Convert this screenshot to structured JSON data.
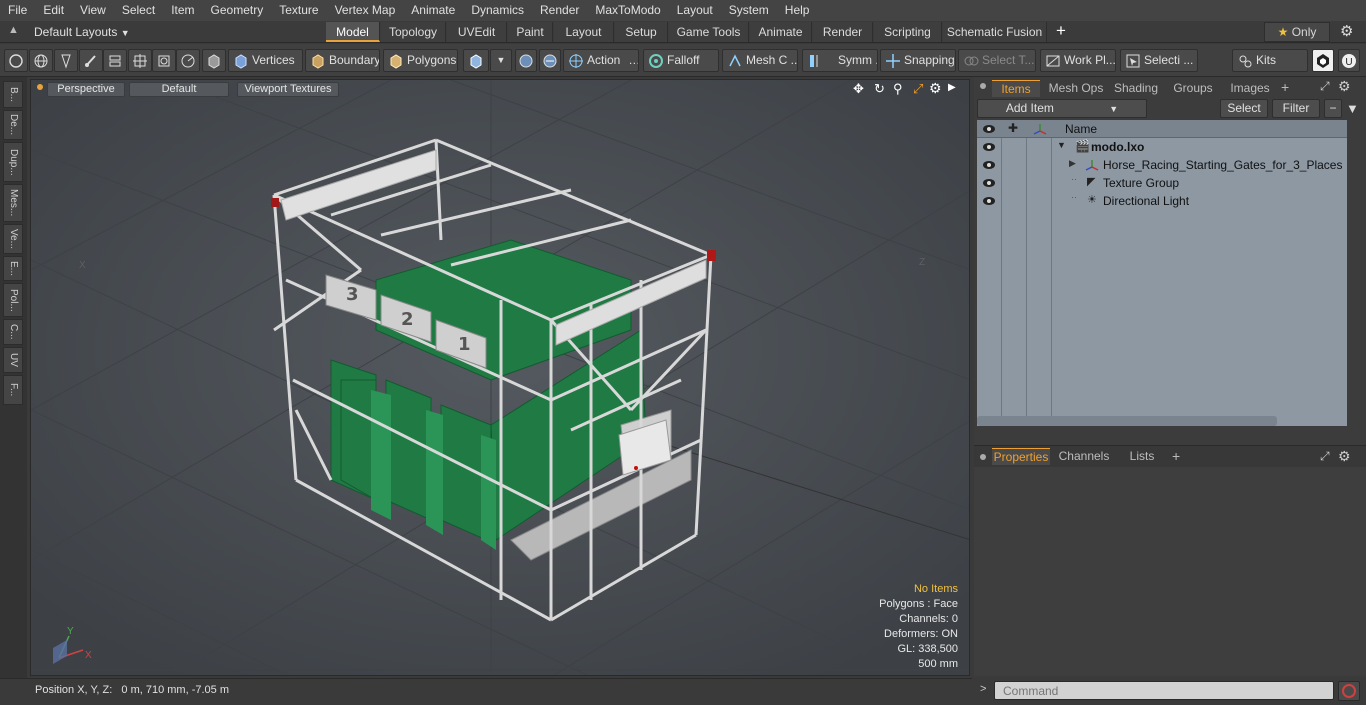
{
  "menu": [
    "File",
    "Edit",
    "View",
    "Select",
    "Item",
    "Geometry",
    "Texture",
    "Vertex Map",
    "Animate",
    "Dynamics",
    "Render",
    "MaxToModo",
    "Layout",
    "System",
    "Help"
  ],
  "layout_selector": "Default Layouts",
  "layout_tabs": [
    "Model",
    "Topology",
    "UVEdit",
    "Paint",
    "Layout",
    "Setup",
    "Game Tools",
    "Animate",
    "Render",
    "Scripting",
    "Schematic Fusion"
  ],
  "layout_tab_active": "Model",
  "only_label": "Only",
  "toolbar": {
    "vertices": "Vertices",
    "boundary": "Boundary",
    "polygons": "Polygons",
    "action": "Action",
    "falloff": "Falloff",
    "mesh": "Mesh C ...",
    "symm": "Symm ...",
    "snapping": "Snapping",
    "select_t": "Select T...",
    "work_plane": "Work Pl...",
    "selecti": "Selecti ...",
    "kits": "Kits"
  },
  "left_tabs": [
    "B...",
    "De...",
    "Dup...",
    "Mes...",
    "Ve...",
    "E...",
    "Pol...",
    "C...",
    "UV",
    "F..."
  ],
  "viewport": {
    "perspective": "Perspective",
    "default": "Default",
    "viewport_textures": "Viewport Textures",
    "no_items": "No Items",
    "polygons": "Polygons : Face",
    "channels": "Channels: 0",
    "deformers": "Deformers: ON",
    "gl": "GL: 338,500",
    "scale": "500 mm",
    "axis_y": "Y",
    "axis_x": "X",
    "axis_z": "Z"
  },
  "status": {
    "position": "Position X, Y, Z:   0 m, 710 mm, -7.05 m"
  },
  "panel": {
    "tabs": [
      "Items",
      "Mesh Ops",
      "Shading",
      "Groups",
      "Images"
    ],
    "add_item": "Add Item",
    "select": "Select",
    "filter": "Filter",
    "name_header": "Name",
    "items": [
      {
        "name": "modo.lxo"
      },
      {
        "name": "Horse_Racing_Starting_Gates_for_3_Places"
      },
      {
        "name": "Texture Group"
      },
      {
        "name": "Directional Light"
      }
    ],
    "bottom_tabs": [
      "Properties",
      "Channels",
      "Lists"
    ],
    "command_placeholder": "Command"
  },
  "colors": {
    "accent": "#f0a030",
    "gate_green": "#1f7a44",
    "frame": "#d8d8d8"
  }
}
